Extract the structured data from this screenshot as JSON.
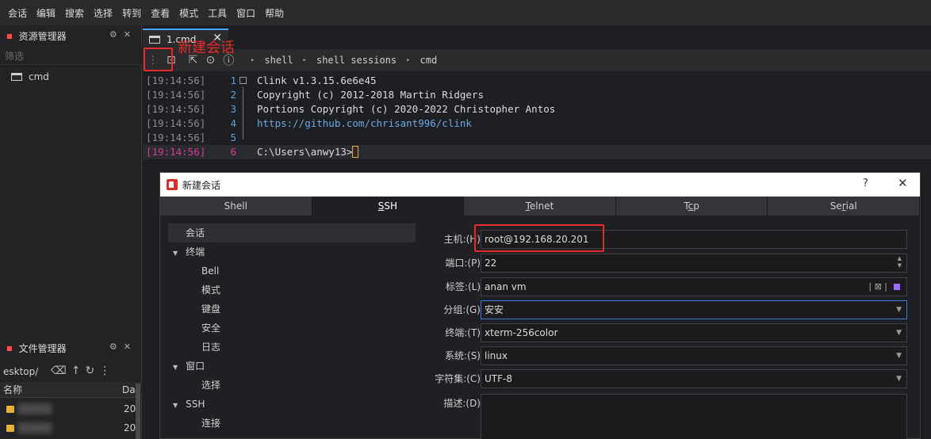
{
  "menu": [
    "会话",
    "编辑",
    "搜索",
    "选择",
    "转到",
    "查看",
    "模式",
    "工具",
    "窗口",
    "帮助"
  ],
  "resource_panel": {
    "title": "资源管理器",
    "filter_placeholder": "筛选",
    "items": [
      "cmd"
    ]
  },
  "file_panel": {
    "title": "文件管理器",
    "path": "esktop/",
    "columns": [
      "名称",
      "Da"
    ],
    "rows": [
      {
        "date": "20"
      },
      {
        "date": "20"
      }
    ]
  },
  "tab": {
    "label": "1.cmd"
  },
  "annotation": {
    "label": "新建会话"
  },
  "breadcrumb": [
    "shell",
    "shell sessions",
    "cmd"
  ],
  "terminal": {
    "lines": [
      {
        "time": "[19:14:56]",
        "num": "1",
        "text": "Clink v1.3.15.6e6e45"
      },
      {
        "time": "[19:14:56]",
        "num": "2",
        "text": "Copyright (c) 2012-2018 Martin Ridgers"
      },
      {
        "time": "[19:14:56]",
        "num": "3",
        "text": "Portions Copyright (c) 2020-2022 Christopher Antos"
      },
      {
        "time": "[19:14:56]",
        "num": "4",
        "text": "https://github.com/chrisant996/clink"
      },
      {
        "time": "[19:14:56]",
        "num": "5",
        "text": ""
      },
      {
        "time": "[19:14:56]",
        "num": "6",
        "text": "C:\\Users\\anwy13>"
      }
    ]
  },
  "dialog": {
    "title": "新建会话",
    "help": "?",
    "close": "✕",
    "tabs": [
      {
        "pre": "",
        "key": "",
        "post": "Shell"
      },
      {
        "pre": "",
        "key": "S",
        "post": "SH"
      },
      {
        "pre": "",
        "key": "T",
        "post": "elnet"
      },
      {
        "pre": "T",
        "key": "c",
        "post": "p"
      },
      {
        "pre": "Se",
        "key": "r",
        "post": "ial"
      }
    ],
    "active_tab": "SSH",
    "tree": {
      "selected": "会话",
      "terminal": "终端",
      "terminal_children": [
        "Bell",
        "模式",
        "键盘",
        "安全",
        "日志"
      ],
      "window": "窗口",
      "window_children": [
        "选择"
      ],
      "ssh": "SSH",
      "ssh_children": [
        "连接"
      ]
    },
    "form": {
      "host_label": "主机:(H)",
      "host_value": "root@192.168.20.201",
      "port_label": "端口:(P)",
      "port_value": "22",
      "tag_label": "标签:(L)",
      "tag_value": "anan vm",
      "group_label": "分组:(G)",
      "group_value": "安安",
      "term_label": "终端:(T)",
      "term_value": "xterm-256color",
      "system_label": "系统:(S)",
      "system_value": "linux",
      "charset_label": "字符集:(C)",
      "charset_value": "UTF-8",
      "desc_label": "描述:(D)",
      "desc_value": ""
    }
  },
  "colors": {
    "accent_red": "#e52b2b",
    "focus_blue": "#3d7bd8",
    "tag_purple": "#9b6cff"
  }
}
